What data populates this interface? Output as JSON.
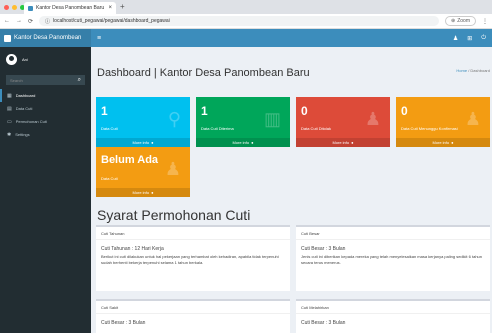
{
  "browser": {
    "tab_title": "Kantor Desa Panombean Baru",
    "tab_close": "×",
    "new_tab": "+",
    "url": "localhost/cuti_pegawai/pegawai/dashboard_pegawai",
    "zoom_label": "Zoom",
    "icons": {
      "back": "←",
      "forward": "→",
      "reload": "⟳",
      "menu": "⋮"
    }
  },
  "sidebar": {
    "brand": "Kantor Desa Panombean",
    "user_name": "Ani",
    "search_placeholder": "Search",
    "items": [
      {
        "label": "Dashboard",
        "icon": "dashboard-icon"
      },
      {
        "label": "Data Cuti",
        "icon": "list-icon"
      },
      {
        "label": "Permohonan Cuti",
        "icon": "file-icon"
      },
      {
        "label": "Settings",
        "icon": "gear-icon"
      }
    ]
  },
  "topbar": {
    "menu_glyph": "≡",
    "icons": [
      "user-icon",
      "grid-icon",
      "power-icon"
    ]
  },
  "content": {
    "title": "Dashboard | Kantor Desa Panombean Baru",
    "breadcrumb_home": "Home",
    "breadcrumb_sep": " / ",
    "breadcrumb_current": "Dashboard",
    "boxes": [
      {
        "num": "1",
        "label": "Data Cuti",
        "more": "More info",
        "color": "#00c0ef"
      },
      {
        "num": "1",
        "label": "Data Cuti Diterima",
        "more": "More info",
        "color": "#00a65a"
      },
      {
        "num": "0",
        "label": "Data Cuti Ditolak",
        "more": "More info",
        "color": "#dd4b39"
      },
      {
        "num": "0",
        "label": "Data Cuti Menunggu Konfirmasi",
        "more": "More info",
        "color": "#f39c12"
      },
      {
        "num": "Belum Ada",
        "label": "Data Cuti",
        "more": "More info",
        "color": "#f39c12"
      }
    ],
    "section_title": "Syarat Permohonan Cuti",
    "cards": [
      {
        "head": "Cuti Tahunan",
        "title": "Cuti Tahunan : 12 Hari Kerja",
        "body": "Berikut ini cuti dilakukan untuk hal pekerjaan yang terhambat oleh kehadiran, apabila tidak terpenuhi sudah berhenti bekerja terpenuhi selama 1 tahun berkala."
      },
      {
        "head": "Cuti Besar",
        "title": "Cuti Besar : 3 Bulan",
        "body": "Jenis cuti ini diberikan kepada mereka yang telah menyelesaikan masa kerjanya paling sedikit 6 tahun secara terus menerus."
      },
      {
        "head": "Cuti Sakit",
        "title": "Cuti Besar : 3 Bulan",
        "body": ""
      },
      {
        "head": "Cuti Melahirkan",
        "title": "Cuti Besar : 3 Bulan",
        "body": ""
      }
    ]
  }
}
